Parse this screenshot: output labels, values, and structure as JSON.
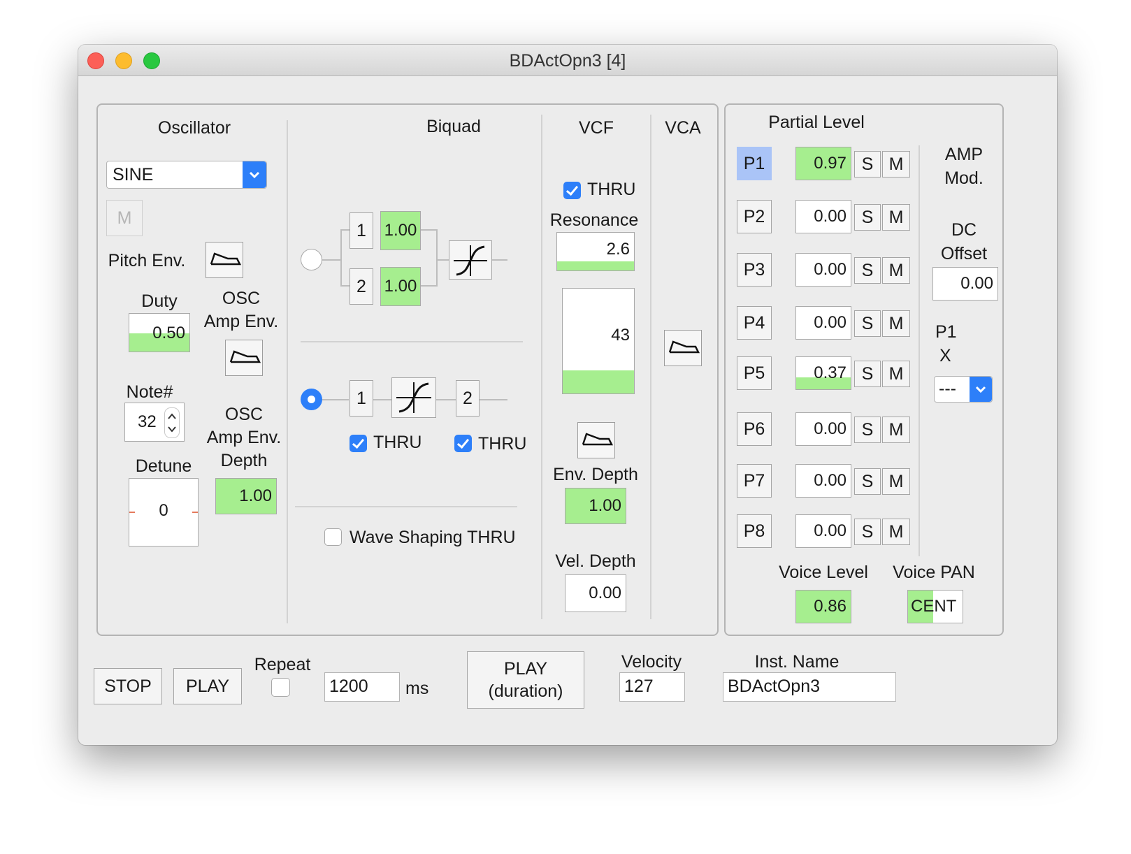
{
  "window": {
    "title": "BDActOpn3 [4]"
  },
  "oscillator": {
    "heading": "Oscillator",
    "waveform": "SINE",
    "m_label": "M",
    "pitch_env_label": "Pitch Env.",
    "duty_label": "Duty",
    "duty_value": "0.50",
    "osc_amp_env_label": [
      "OSC",
      "Amp Env."
    ],
    "note_label": "Note#",
    "note_value": "32",
    "osc_amp_env_depth_label": [
      "OSC",
      "Amp Env.",
      "Depth"
    ],
    "osc_amp_env_depth_value": "1.00",
    "detune_label": "Detune",
    "detune_value": "0"
  },
  "biquad": {
    "heading": "Biquad",
    "filter1_label": "1",
    "filter1_value": "1.00",
    "filter2_label": "2",
    "filter2_value": "1.00",
    "serial_filter1_label": "1",
    "serial_filter2_label": "2",
    "thru_label": "THRU",
    "thru2_label": "THRU",
    "wave_shaping_label": "Wave Shaping THRU"
  },
  "vcf": {
    "heading": "VCF",
    "thru_label": "THRU",
    "resonance_label": "Resonance",
    "resonance_value": "2.6",
    "cutoff_value": "43",
    "env_depth_label": "Env. Depth",
    "env_depth_value": "1.00",
    "vel_depth_label": "Vel. Depth",
    "vel_depth_value": "0.00"
  },
  "vca": {
    "heading": "VCA"
  },
  "partial_level": {
    "heading": "Partial Level",
    "solo_label": "S",
    "mute_label": "M",
    "partials": [
      {
        "label": "P1",
        "value": "0.97",
        "level": 1.0,
        "selected": true
      },
      {
        "label": "P2",
        "value": "0.00",
        "level": 0.0,
        "selected": false
      },
      {
        "label": "P3",
        "value": "0.00",
        "level": 0.0,
        "selected": false
      },
      {
        "label": "P4",
        "value": "0.00",
        "level": 0.0,
        "selected": false
      },
      {
        "label": "P5",
        "value": "0.37",
        "level": 0.37,
        "selected": false
      },
      {
        "label": "P6",
        "value": "0.00",
        "level": 0.0,
        "selected": false
      },
      {
        "label": "P7",
        "value": "0.00",
        "level": 0.0,
        "selected": false
      },
      {
        "label": "P8",
        "value": "0.00",
        "level": 0.0,
        "selected": false
      }
    ],
    "amp_mod_label": [
      "AMP",
      "Mod."
    ],
    "dc_offset_label": [
      "DC",
      "Offset"
    ],
    "dc_offset_value": "0.00",
    "p1x_label": [
      "P1",
      "X"
    ],
    "p1x_select_value": "---",
    "voice_level_label": "Voice Level",
    "voice_level_value": "0.86",
    "voice_pan_label": "Voice PAN",
    "voice_pan_value": "CENT"
  },
  "transport": {
    "stop_label": "STOP",
    "play_label": "PLAY",
    "repeat_label": "Repeat",
    "repeat_ms_value": "1200",
    "ms_label": "ms",
    "play_duration_label": [
      "PLAY",
      "(duration)"
    ],
    "velocity_label": "Velocity",
    "velocity_value": "127",
    "inst_name_label": "Inst. Name",
    "inst_name_value": "BDActOpn3"
  },
  "colors": {
    "value_green": "#a6ee8f",
    "accent_blue": "#2d7ff9",
    "selected_partial": "#aac4f7",
    "close": "#fc5f57",
    "minimize": "#fdbc2e",
    "zoom": "#29c840"
  }
}
